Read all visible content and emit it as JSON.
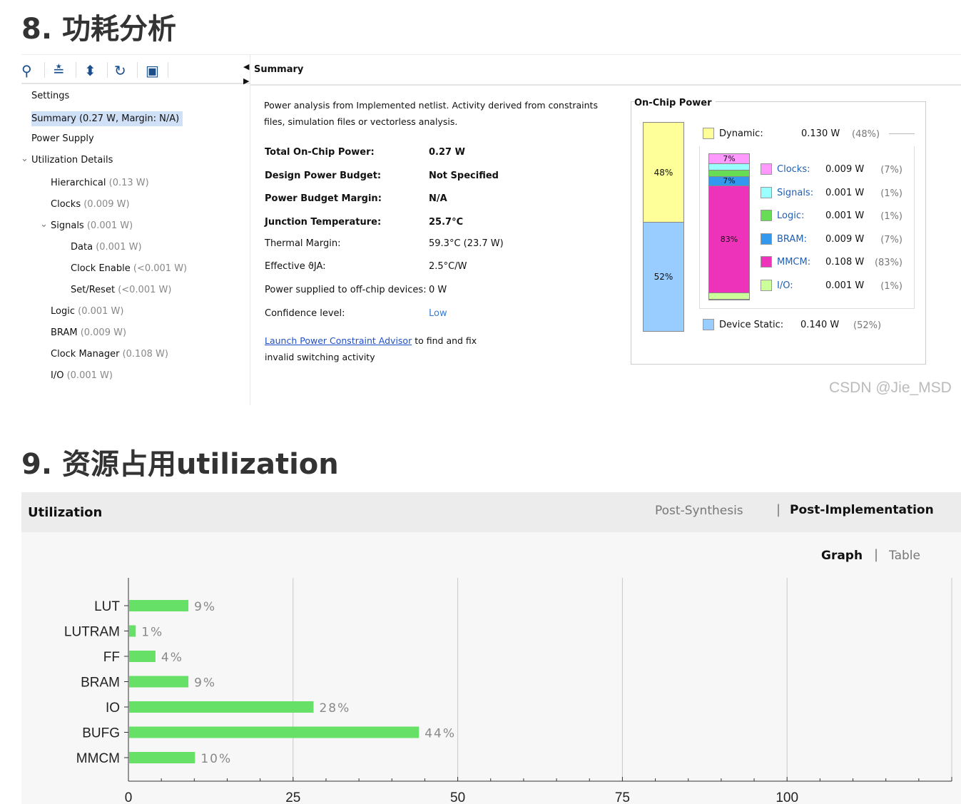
{
  "section8": {
    "title": "8. 功耗分析"
  },
  "toolbar": {
    "icons": [
      "search-icon",
      "collapse-all-icon",
      "expand-all-icon",
      "refresh-icon",
      "save-icon"
    ]
  },
  "tree": {
    "items": [
      {
        "label": "Settings",
        "value": ""
      },
      {
        "label": "Summary",
        "value": "(0.27 W, Margin: N/A)"
      },
      {
        "label": "Power Supply",
        "value": ""
      },
      {
        "label": "Utilization Details",
        "value": ""
      },
      {
        "label": "Hierarchical",
        "value": "(0.13 W)"
      },
      {
        "label": "Clocks",
        "value": "(0.009 W)"
      },
      {
        "label": "Signals",
        "value": "(0.001 W)"
      },
      {
        "label": "Data",
        "value": "(0.001 W)"
      },
      {
        "label": "Clock Enable",
        "value": "(<0.001 W)"
      },
      {
        "label": "Set/Reset",
        "value": "(<0.001 W)"
      },
      {
        "label": "Logic",
        "value": "(0.001 W)"
      },
      {
        "label": "BRAM",
        "value": "(0.009 W)"
      },
      {
        "label": "Clock Manager",
        "value": "(0.108 W)"
      },
      {
        "label": "I/O",
        "value": "(0.001 W)"
      }
    ]
  },
  "summary": {
    "tab": "Summary",
    "desc1": "Power analysis from Implemented netlist. Activity derived from constraints",
    "desc2": "files, simulation files or vectorless analysis.",
    "rows": [
      {
        "label": "Total On-Chip Power:",
        "value": "0.27 W"
      },
      {
        "label": "Design Power Budget:",
        "value": "Not Specified"
      },
      {
        "label": "Power Budget Margin:",
        "value": "N/A"
      },
      {
        "label": "Junction Temperature:",
        "value": "25.7°C"
      },
      {
        "label": "Thermal Margin:",
        "value": "59.3°C (23.7 W)"
      },
      {
        "label": "Effective ϑJA:",
        "value": "2.5°C/W"
      },
      {
        "label": "Power supplied to off-chip devices:",
        "value": "0 W"
      },
      {
        "label": "Confidence level:",
        "value": "Low"
      }
    ],
    "link": "Launch Power Constraint Advisor",
    "link_after": "to find and fix",
    "link_after2": "invalid switching activity"
  },
  "onchip": {
    "title": "On-Chip Power",
    "dynamic": {
      "label": "Dynamic:",
      "value": "0.130 W",
      "pct": "(48%)",
      "bar": "48%",
      "color": "#ffff99"
    },
    "static": {
      "label": "Device Static:",
      "value": "0.140 W",
      "pct": "(52%)",
      "bar": "52%",
      "color": "#99ccff"
    },
    "items": [
      {
        "label": "Clocks:",
        "value": "0.009 W",
        "pct": "(7%)",
        "share": 7,
        "bar": "7%",
        "color": "#ff99ff"
      },
      {
        "label": "Signals:",
        "value": "0.001 W",
        "pct": "(1%)",
        "share": 1,
        "bar": "",
        "color": "#99ffff"
      },
      {
        "label": "Logic:",
        "value": "0.001 W",
        "pct": "(1%)",
        "share": 1,
        "bar": "",
        "color": "#66dd55"
      },
      {
        "label": "BRAM:",
        "value": "0.009 W",
        "pct": "(7%)",
        "share": 7,
        "bar": "7%",
        "color": "#3399ee"
      },
      {
        "label": "MMCM:",
        "value": "0.108 W",
        "pct": "(83%)",
        "share": 83,
        "bar": "83%",
        "color": "#ee33bb"
      },
      {
        "label": "I/O:",
        "value": "0.001 W",
        "pct": "(1%)",
        "share": 1,
        "bar": "",
        "color": "#ccff99"
      }
    ]
  },
  "watermark": "CSDN @Jie_MSD",
  "section9": {
    "title": "9. 资源占用utilization"
  },
  "util": {
    "title": "Utilization",
    "tab1": "Post-Synthesis",
    "tab2": "Post-Implementation",
    "view1": "Graph",
    "view2": "Table"
  },
  "chart_data": {
    "type": "bar",
    "orientation": "horizontal",
    "categories": [
      "LUT",
      "LUTRAM",
      "FF",
      "BRAM",
      "IO",
      "BUFG",
      "MMCM"
    ],
    "values": [
      9,
      1,
      4,
      9,
      28,
      44,
      10
    ],
    "labels": [
      "9%",
      "1%",
      "4%",
      "9%",
      "28%",
      "44%",
      "10%"
    ],
    "xticks": [
      "0",
      "25",
      "50",
      "75",
      "100"
    ],
    "xlim": [
      0,
      125
    ],
    "grid": true,
    "color": "#66e066"
  }
}
